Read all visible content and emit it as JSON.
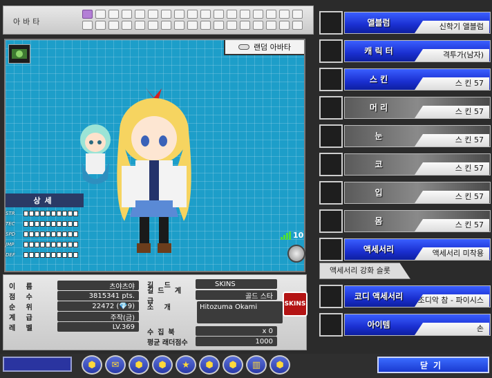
{
  "header": {
    "title": "아바타",
    "slots_on": [
      0
    ]
  },
  "preview": {
    "random_label": "랜덤 아바타",
    "signal_value": "10"
  },
  "detail": {
    "title": "상세",
    "stats": [
      "STR",
      "TEC",
      "SPD",
      "JMP",
      "DEF"
    ]
  },
  "info": {
    "name_k": "이 름",
    "name_v": "츠야츠야",
    "score_k": "점 수",
    "score_v": "3815341 pts.",
    "rank_k": "순 위",
    "rank_v": "22472 (💎9)",
    "class_k": "계 급",
    "class_v": "주작(금)",
    "level_k": "레 벨",
    "level_v": "LV.369",
    "guild_k": "길 드",
    "guild_v": "SKINS",
    "guildrank_k": "길드 계급",
    "guildrank_v": "골드 스타",
    "intro_k": "소 개",
    "intro_v": "Hitozuma Okami",
    "book_k": "수집북",
    "book_v": "x 0",
    "ladder_k": "평균 래더점수",
    "ladder_v": "1000",
    "badge": "SKINS"
  },
  "right": [
    {
      "name": "앨블럼",
      "value": "신학기 앨블럼",
      "blue": true
    },
    {
      "name": "캐 릭 터",
      "value": "격투가(남자)",
      "blue": true
    },
    {
      "name": "스    킨",
      "value": "스   킨 57",
      "blue": true
    },
    {
      "name": "머    리",
      "value": "스   킨 57",
      "blue": false
    },
    {
      "name": "눈",
      "value": "스   킨 57",
      "blue": false
    },
    {
      "name": "코",
      "value": "스   킨 57",
      "blue": false
    },
    {
      "name": "입",
      "value": "스   킨 57",
      "blue": false
    },
    {
      "name": "몸",
      "value": "스   킨 57",
      "blue": false
    },
    {
      "name": "액세서리",
      "value": "액세서리 미착용",
      "blue": true
    }
  ],
  "acc_slot": "액세서리 강화 슬롯",
  "extra": [
    {
      "name": "코디 액세서리",
      "value": "조디악 참 - 파이시스",
      "blue": true
    },
    {
      "name": "아이템",
      "value": "손",
      "blue": true
    }
  ],
  "bottom": {
    "icons": [
      "⬢",
      "✉",
      "⬢",
      "⬢",
      "★",
      "⬢",
      "⬢",
      "▥",
      "⬢"
    ],
    "close": "닫기"
  }
}
